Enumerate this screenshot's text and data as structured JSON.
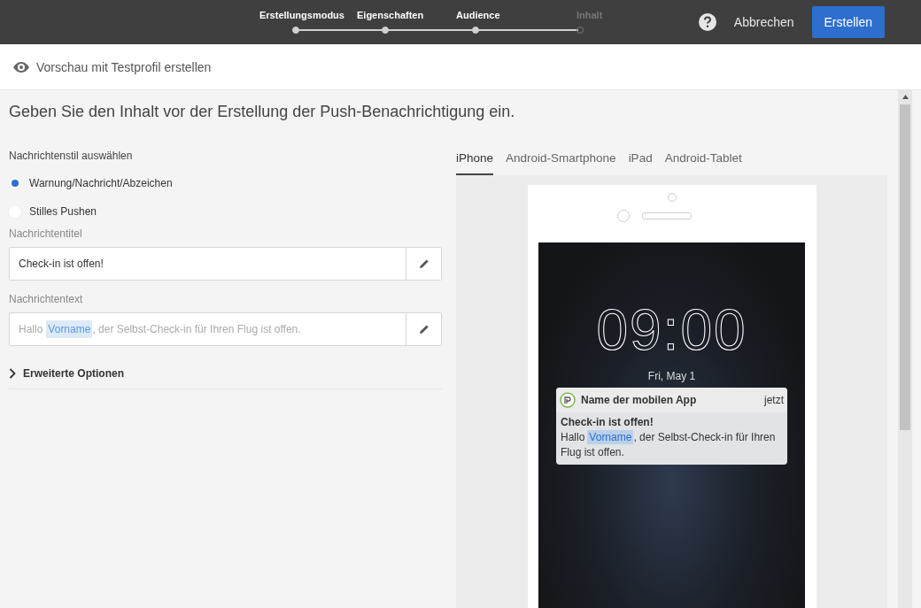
{
  "steps": [
    {
      "label": "Erstellungsmodus",
      "completed": true
    },
    {
      "label": "Eigenschaften",
      "completed": true
    },
    {
      "label": "Audience",
      "completed": true
    },
    {
      "label": "Inhalt",
      "completed": false
    }
  ],
  "header_actions": {
    "cancel": "Abbrechen",
    "create": "Erstellen"
  },
  "preview_link": "Vorschau mit Testprofil erstellen",
  "heading": "Geben Sie den Inhalt vor der Erstellung der Push-Benachrichtigung ein.",
  "style_section": {
    "label": "Nachrichtenstil auswählen",
    "options": [
      {
        "label": "Warnung/Nachricht/Abzeichen",
        "selected": true
      },
      {
        "label": "Stilles Pushen",
        "selected": false
      }
    ]
  },
  "title_field": {
    "label": "Nachrichtentitel",
    "value": "Check-in ist offen!"
  },
  "text_field": {
    "label": "Nachrichtentext",
    "prefix": "Hallo",
    "token": "Vorname",
    "suffix": ", der Selbst-Check-in für Ihren Flug ist offen."
  },
  "advanced": {
    "label": "Erweiterte Optionen",
    "expanded": false
  },
  "device_tabs": [
    {
      "label": "iPhone",
      "selected": true
    },
    {
      "label": "Android-Smartphone",
      "selected": false
    },
    {
      "label": "iPad",
      "selected": false
    },
    {
      "label": "Android-Tablet",
      "selected": false
    }
  ],
  "lock_screen": {
    "time": "09:00",
    "date": "Fri, May 1"
  },
  "notification": {
    "app_name": "Name der mobilen App",
    "time": "jetzt",
    "title": "Check-in ist offen!",
    "prefix": "Hallo",
    "token": "Vorname",
    "suffix": ", der Selbst-Check-in für Ihren Flug ist offen."
  }
}
